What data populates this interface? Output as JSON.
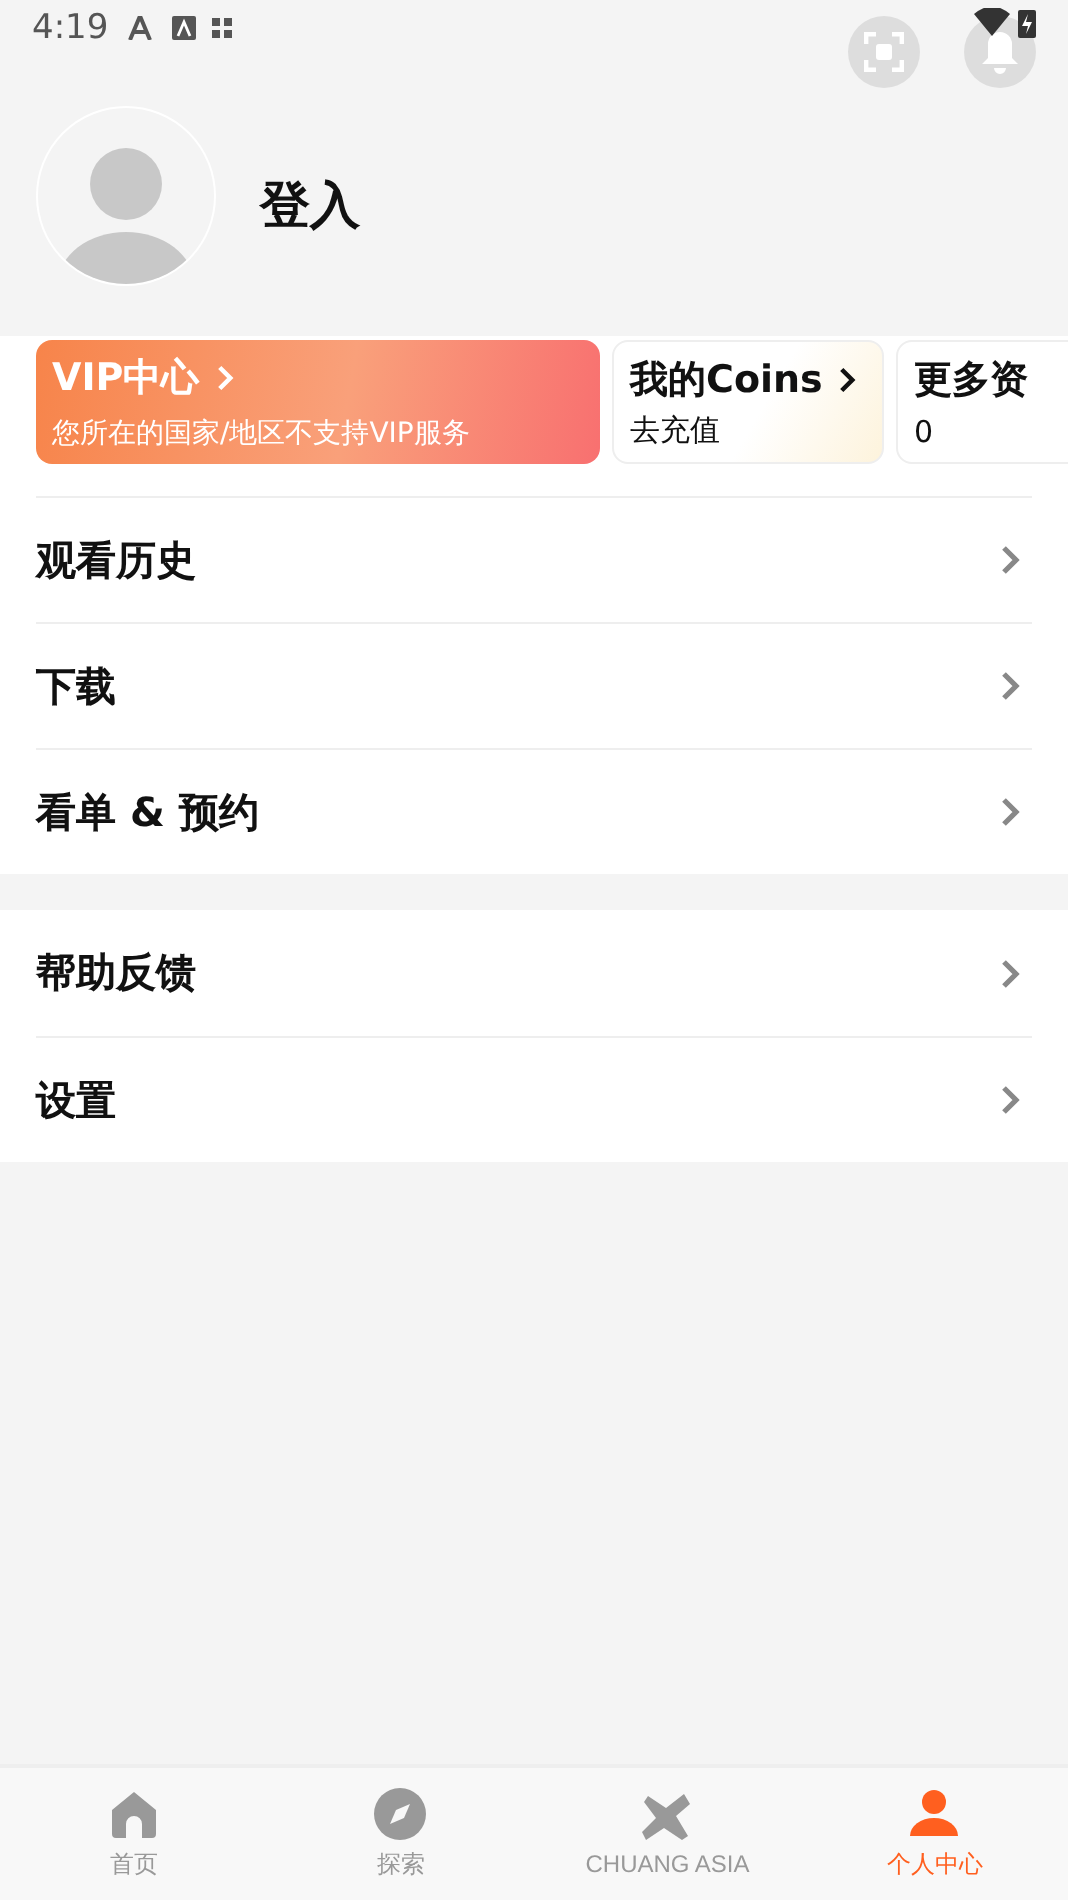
{
  "status_bar": {
    "time": "4:19"
  },
  "profile": {
    "login": "登入"
  },
  "cards": [
    {
      "kind": "vip",
      "title": "VIP中心",
      "subtitle": "您所在的国家/地区不支持VIP服务"
    },
    {
      "kind": "coins",
      "title": "我的Coins",
      "subtitle": "去充值"
    },
    {
      "kind": "more",
      "title": "更多资",
      "subtitle": "0"
    }
  ],
  "menu_groups": [
    [
      {
        "label": "观看历史"
      },
      {
        "label": "下载"
      },
      {
        "label": "看单 & 预约"
      }
    ],
    [
      {
        "label": "帮助反馈"
      },
      {
        "label": "设置"
      }
    ]
  ],
  "tabs": [
    {
      "label": "首页",
      "kind": "home",
      "selected": false
    },
    {
      "label": "探索",
      "kind": "explore",
      "selected": false
    },
    {
      "label": "CHUANG ASIA",
      "kind": "brand",
      "selected": false
    },
    {
      "label": "个人中心",
      "kind": "profile",
      "selected": true
    }
  ]
}
